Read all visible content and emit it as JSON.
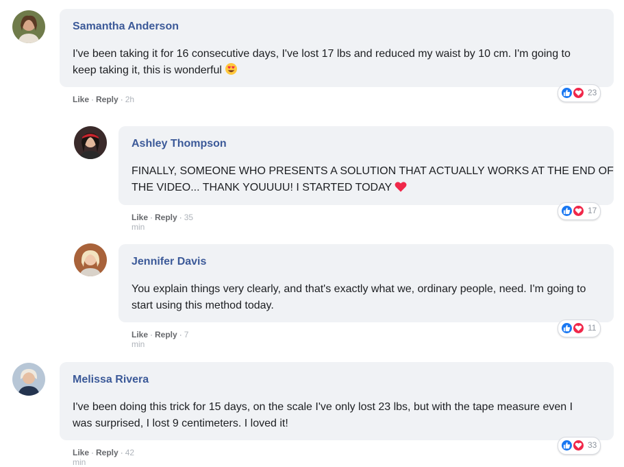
{
  "comments": [
    {
      "author": "Samantha Anderson",
      "text_lines": [
        "I've been taking it for 16 consecutive days, I've lost 17 lbs and reduced my waist by 10 cm. I'm going to",
        "keep taking it, this is wonderful"
      ],
      "emoji": "heart-eyes-emoji",
      "like_label": "Like",
      "reply_label": "Reply",
      "time": "2h",
      "reaction_count": "23",
      "avatar": "avatar-photo"
    },
    {
      "author": "Ashley Thompson",
      "text_lines": [
        "FINALLY, SOMEONE WHO PRESENTS A SOLUTION THAT ACTUALLY WORKS AT THE END OF",
        "THE VIDEO... THANK YOUUUU! I STARTED TODAY"
      ],
      "emoji": "red-heart-emoji",
      "like_label": "Like",
      "reply_label": "Reply",
      "time": "35 min",
      "reaction_count": "17",
      "avatar": "avatar-photo"
    },
    {
      "author": "Jennifer Davis",
      "text_lines": [
        "You explain things very clearly, and that's exactly what we, ordinary people, need. I'm going to",
        "start using this method today."
      ],
      "like_label": "Like",
      "reply_label": "Reply",
      "time": "7 min",
      "reaction_count": "11",
      "avatar": "avatar-photo"
    },
    {
      "author": "Melissa Rivera",
      "text_lines": [
        "I've been doing this trick for 15 days, on the scale I've only lost 23 lbs, but with the tape measure even I",
        "was surprised, I lost 9 centimeters. I loved it!"
      ],
      "like_label": "Like",
      "reply_label": "Reply",
      "time": "42 min",
      "reaction_count": "33",
      "avatar": "avatar-photo"
    }
  ],
  "separator": "·",
  "colors": {
    "author": "#3b5998",
    "bubble": "#f0f2f5",
    "like": "#1877f2",
    "love": "#f0284a"
  }
}
